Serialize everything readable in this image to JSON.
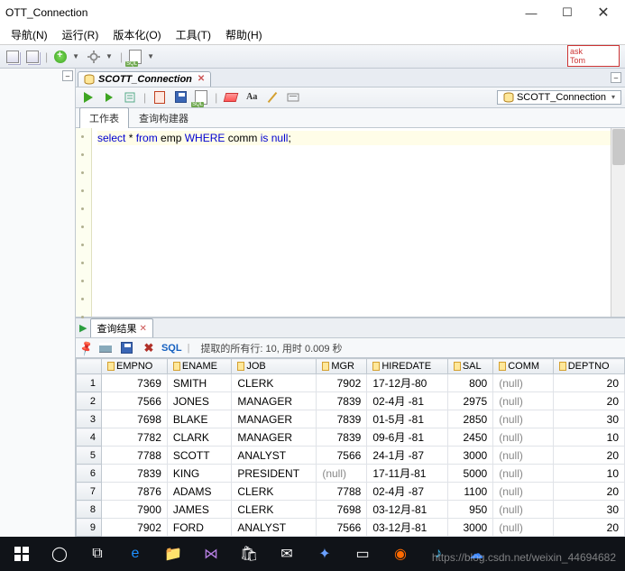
{
  "window": {
    "title": "OTT_Connection"
  },
  "menu": {
    "nav": "导航(N)",
    "run": "运行(R)",
    "version": "版本化(O)",
    "tools": "工具(T)",
    "help": "帮助(H)"
  },
  "ask_box": {
    "line1": "ask",
    "line2": "Tom"
  },
  "doctab": {
    "label": "SCOTT_Connection"
  },
  "db_indicator": {
    "label": "SCOTT_Connection"
  },
  "view_tabs": {
    "worksheet": "工作表",
    "query_builder": "查询构建器"
  },
  "sql": {
    "tokens": [
      "select",
      " * ",
      "from",
      " emp ",
      "WHERE",
      " comm ",
      "is",
      " ",
      "null",
      ";"
    ]
  },
  "results_tab": {
    "label": "查询结果"
  },
  "results_toolbar": {
    "sql_label": "SQL",
    "status": "提取的所有行: 10, 用时 0.009 秒"
  },
  "columns": [
    "EMPNO",
    "ENAME",
    "JOB",
    "MGR",
    "HIREDATE",
    "SAL",
    "COMM",
    "DEPTNO"
  ],
  "rows": [
    {
      "n": 1,
      "EMPNO": "7369",
      "ENAME": "SMITH",
      "JOB": "CLERK",
      "MGR": "7902",
      "HIREDATE": "17-12月-80",
      "SAL": "800",
      "COMM": "(null)",
      "DEPTNO": "20"
    },
    {
      "n": 2,
      "EMPNO": "7566",
      "ENAME": "JONES",
      "JOB": "MANAGER",
      "MGR": "7839",
      "HIREDATE": "02-4月 -81",
      "SAL": "2975",
      "COMM": "(null)",
      "DEPTNO": "20"
    },
    {
      "n": 3,
      "EMPNO": "7698",
      "ENAME": "BLAKE",
      "JOB": "MANAGER",
      "MGR": "7839",
      "HIREDATE": "01-5月 -81",
      "SAL": "2850",
      "COMM": "(null)",
      "DEPTNO": "30"
    },
    {
      "n": 4,
      "EMPNO": "7782",
      "ENAME": "CLARK",
      "JOB": "MANAGER",
      "MGR": "7839",
      "HIREDATE": "09-6月 -81",
      "SAL": "2450",
      "COMM": "(null)",
      "DEPTNO": "10"
    },
    {
      "n": 5,
      "EMPNO": "7788",
      "ENAME": "SCOTT",
      "JOB": "ANALYST",
      "MGR": "7566",
      "HIREDATE": "24-1月 -87",
      "SAL": "3000",
      "COMM": "(null)",
      "DEPTNO": "20"
    },
    {
      "n": 6,
      "EMPNO": "7839",
      "ENAME": "KING",
      "JOB": "PRESIDENT",
      "MGR": "(null)",
      "HIREDATE": "17-11月-81",
      "SAL": "5000",
      "COMM": "(null)",
      "DEPTNO": "10"
    },
    {
      "n": 7,
      "EMPNO": "7876",
      "ENAME": "ADAMS",
      "JOB": "CLERK",
      "MGR": "7788",
      "HIREDATE": "02-4月 -87",
      "SAL": "1100",
      "COMM": "(null)",
      "DEPTNO": "20"
    },
    {
      "n": 8,
      "EMPNO": "7900",
      "ENAME": "JAMES",
      "JOB": "CLERK",
      "MGR": "7698",
      "HIREDATE": "03-12月-81",
      "SAL": "950",
      "COMM": "(null)",
      "DEPTNO": "30"
    },
    {
      "n": 9,
      "EMPNO": "7902",
      "ENAME": "FORD",
      "JOB": "ANALYST",
      "MGR": "7566",
      "HIREDATE": "03-12月-81",
      "SAL": "3000",
      "COMM": "(null)",
      "DEPTNO": "20"
    }
  ],
  "watermark": "https://blog.csdn.net/weixin_44694682"
}
